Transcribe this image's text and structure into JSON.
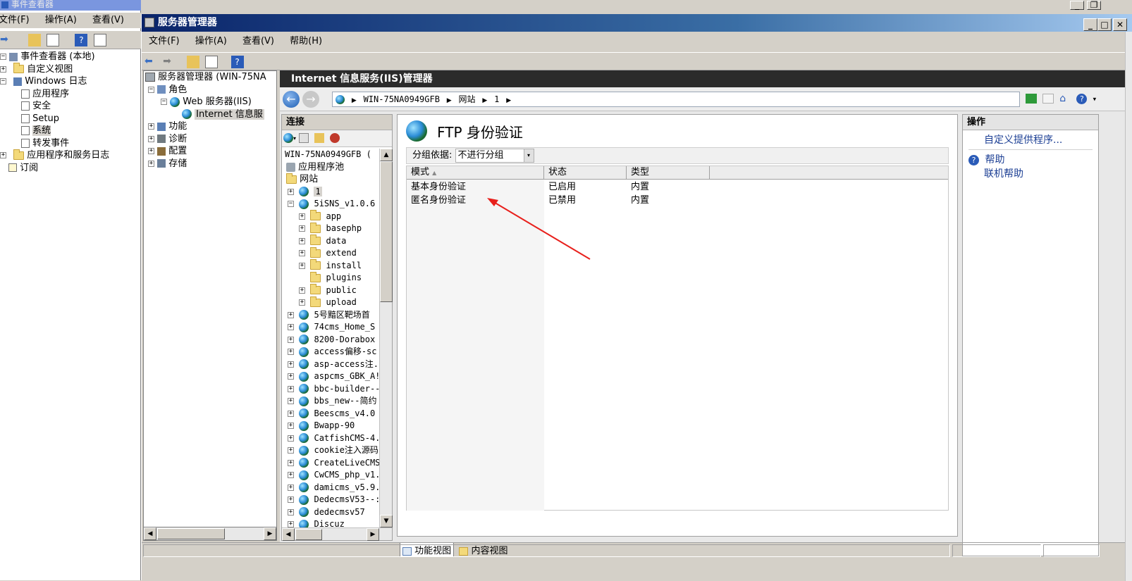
{
  "event_viewer": {
    "title": "事件查看器",
    "menu": [
      "文件(F)",
      "操作(A)",
      "查看(V)"
    ],
    "tree": [
      {
        "label": "事件查看器 (本地)",
        "level": 0
      },
      {
        "label": "自定义视图",
        "level": 1
      },
      {
        "label": "Windows 日志",
        "level": 1
      },
      {
        "label": "应用程序",
        "level": 2
      },
      {
        "label": "安全",
        "level": 2
      },
      {
        "label": "Setup",
        "level": 2
      },
      {
        "label": "系统",
        "level": 2
      },
      {
        "label": "转发事件",
        "level": 2
      },
      {
        "label": "应用程序和服务日志",
        "level": 1
      },
      {
        "label": "订阅",
        "level": 1
      }
    ]
  },
  "server_manager": {
    "title": "服务器管理器",
    "menu": [
      "文件(F)",
      "操作(A)",
      "查看(V)",
      "帮助(H)"
    ],
    "tree": [
      {
        "label": "服务器管理器 (WIN-75NA"
      },
      {
        "label": "角色"
      },
      {
        "label": "Web 服务器(IIS)"
      },
      {
        "label": "Internet 信息服"
      },
      {
        "label": "功能"
      },
      {
        "label": "诊断"
      },
      {
        "label": "配置"
      },
      {
        "label": "存储"
      }
    ]
  },
  "iis": {
    "title": "Internet 信息服务(IIS)管理器",
    "breadcrumb": [
      "WIN-75NA0949GFB",
      "网站",
      "1"
    ],
    "connections": {
      "header": "连接",
      "server": "WIN-75NA0949GFB (",
      "app_pools": "应用程序池",
      "sites_label": "网站",
      "sites_top": [
        "1",
        "5iSNS_v1.0.6"
      ],
      "folders": [
        "app",
        "basephp",
        "data",
        "extend",
        "install",
        "plugins",
        "public",
        "upload"
      ],
      "sites_rest": [
        "5号黯区靶场首",
        "74cms_Home_S",
        "8200-Dorabox",
        "access偏移-sc",
        "asp-access注.",
        "aspcms_GBK_A!",
        "bbc-builder--",
        "bbs_new--简约",
        "Beescms_v4.0",
        "Bwapp-90",
        "CatfishCMS-4.",
        "cookie注入源码",
        "CreateLiveCMS",
        "CwCMS_php_v1.",
        "damicms_v5.9.",
        "DedecmsV53--:",
        "dedecmsv57",
        "Discuz"
      ]
    },
    "feature": {
      "title": "FTP 身份验证",
      "group_by_label": "分组依据:",
      "group_by_value": "不进行分组",
      "columns": [
        "模式",
        "状态",
        "类型"
      ],
      "rows": [
        [
          "基本身份验证",
          "已启用",
          "内置"
        ],
        [
          "匿名身份验证",
          "已禁用",
          "内置"
        ]
      ]
    },
    "bottom_tabs": [
      "功能视图",
      "内容视图"
    ],
    "actions": {
      "header": "操作",
      "items": [
        "自定义提供程序..."
      ],
      "help": [
        "帮助",
        "联机帮助"
      ]
    }
  },
  "colors": {
    "accent_red": "#e8201c",
    "title_dark": "#2b2b2b",
    "selection": "#d6d3ce"
  }
}
